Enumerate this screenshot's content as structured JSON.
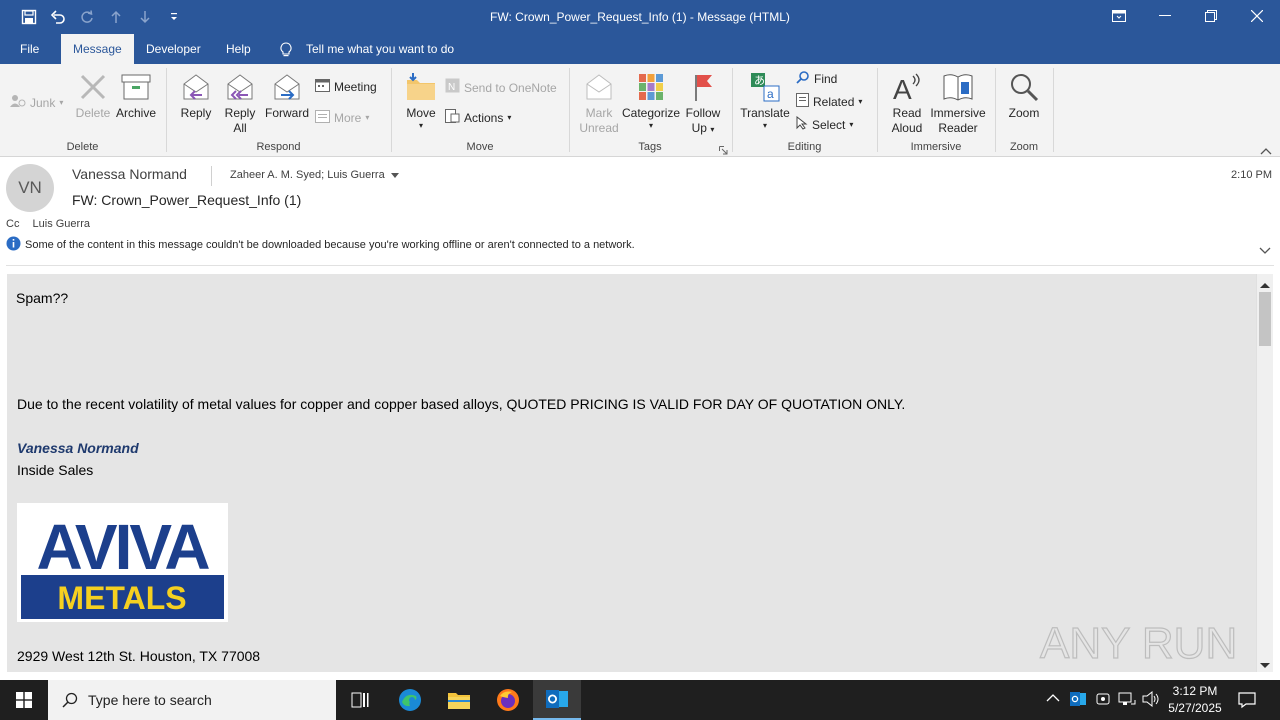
{
  "window": {
    "title": "FW: Crown_Power_Request_Info (1)  -  Message (HTML)"
  },
  "menu": {
    "tabs": [
      "File",
      "Message",
      "Developer",
      "Help"
    ],
    "tell_me": "Tell me what you want to do"
  },
  "ribbon": {
    "delete_group": {
      "label": "Delete",
      "junk": "Junk",
      "delete": "Delete",
      "archive": "Archive"
    },
    "respond_group": {
      "label": "Respond",
      "reply": "Reply",
      "reply_all_1": "Reply",
      "reply_all_2": "All",
      "forward": "Forward",
      "meeting": "Meeting",
      "more": "More"
    },
    "move_group": {
      "label": "Move",
      "move": "Move",
      "send_onenote": "Send to OneNote",
      "actions": "Actions"
    },
    "tags_group": {
      "label": "Tags",
      "mark_unread_1": "Mark",
      "mark_unread_2": "Unread",
      "categorize": "Categorize",
      "follow_up_1": "Follow",
      "follow_up_2": "Up"
    },
    "editing_group": {
      "label": "Editing",
      "translate": "Translate",
      "find": "Find",
      "related": "Related",
      "select": "Select"
    },
    "immersive_group": {
      "label": "Immersive",
      "read_aloud_1": "Read",
      "read_aloud_2": "Aloud",
      "immersive_reader_1": "Immersive",
      "immersive_reader_2": "Reader"
    },
    "zoom_group": {
      "label": "Zoom",
      "zoom": "Zoom"
    }
  },
  "message": {
    "initials": "VN",
    "sender": "Vanessa Normand",
    "to": "Zaheer A. M. Syed; Luis Guerra",
    "subject": "FW: Crown_Power_Request_Info (1)",
    "time": "2:10 PM",
    "cc_label": "Cc",
    "cc": "Luis Guerra",
    "info": "Some of the content in this message couldn't be downloaded because you're working offline or aren't connected to a network."
  },
  "body": {
    "line1": "Spam??",
    "notice": "Due to the recent volatility of metal values for copper and copper based alloys, QUOTED PRICING IS VALID FOR DAY OF QUOTATION ONLY.",
    "sig_name": "Vanessa Normand",
    "sig_title": "Inside Sales",
    "logo_top": "AVIVA",
    "logo_bottom": "METALS",
    "address": "2929 West 12th St.  Houston, TX 77008"
  },
  "watermark": "ANY RUN",
  "taskbar": {
    "search_placeholder": "Type here to search",
    "time": "3:12 PM",
    "date": "5/27/2025"
  },
  "colors": {
    "accent": "#2b579a",
    "signature_blue": "#1f3a6e",
    "logo_yellow": "#f5d020",
    "logo_navy": "#1c3f8c"
  }
}
